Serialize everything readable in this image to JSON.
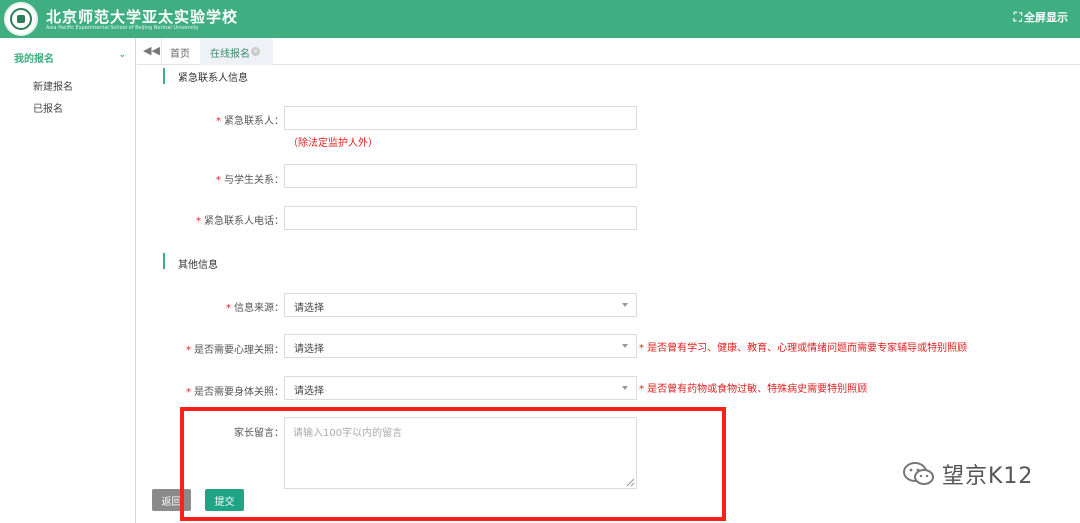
{
  "header": {
    "school_name": "北京师范大学亚太实验学校",
    "school_subtitle": "Asia Pacific Experimental School of Beijing Normal University",
    "fullscreen_label": "全屏显示",
    "brand_color": "#3fae80"
  },
  "sidebar": {
    "group_label": "我的报名",
    "items": [
      {
        "label": "新建报名"
      },
      {
        "label": "已报名"
      }
    ]
  },
  "tabs": {
    "home": "首页",
    "active": "在线报名"
  },
  "form": {
    "section_emergency": "紧急联系人信息",
    "emergency_contact": {
      "label": "紧急联系人：",
      "value": "",
      "note": "（除法定监护人外）"
    },
    "relation": {
      "label": "与学生关系：",
      "value": ""
    },
    "contact_phone": {
      "label": "紧急联系人电话：",
      "value": ""
    },
    "section_other": "其他信息",
    "info_source": {
      "label": "信息来源：",
      "value": "请选择"
    },
    "psych_care": {
      "label": "是否需要心理关照：",
      "value": "请选择",
      "note": "* 是否曾有学习、健康、教育、心理或情绪问题而需要专家辅导或特别照顾"
    },
    "physical_care": {
      "label": "是否需要身体关照：",
      "value": "请选择",
      "note": "* 是否曾有药物或食物过敏、特殊病史需要特别照顾"
    },
    "parent_message": {
      "label": "家长留言：",
      "placeholder": "请输入100字以内的留言",
      "value": ""
    },
    "back_button": "返回",
    "submit_button": "提交"
  },
  "watermark": {
    "text": "望京K12"
  }
}
